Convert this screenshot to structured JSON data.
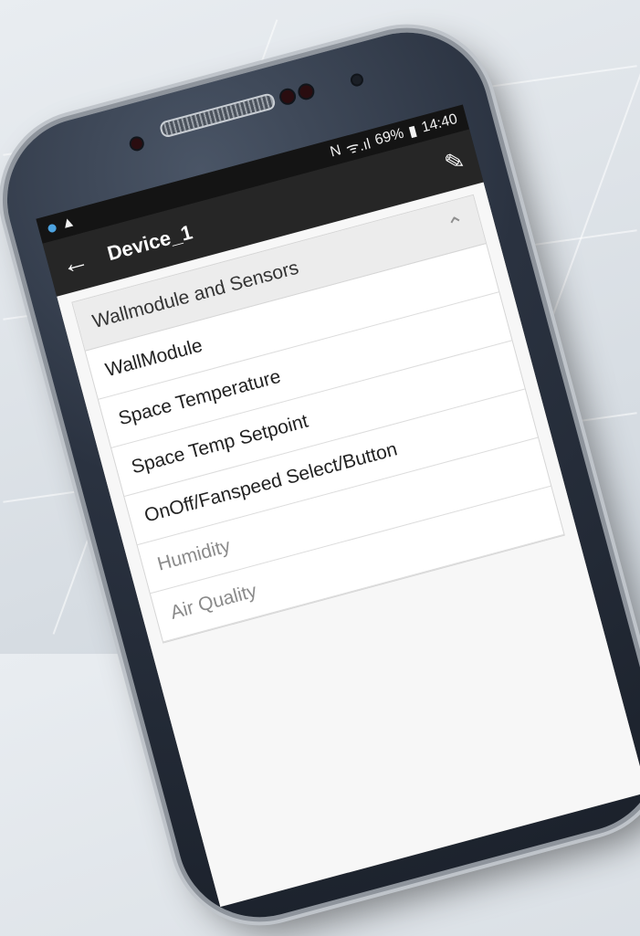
{
  "status": {
    "nfc": "N",
    "signal": "ᯤ.ıl",
    "battery_pct": "69%",
    "time": "14:40"
  },
  "appbar": {
    "back_icon": "←",
    "title": "Device_1",
    "edit_icon": "✎"
  },
  "section": {
    "title": "Wallmodule and Sensors",
    "chevron": "⌃"
  },
  "items": [
    {
      "label": "WallModule"
    },
    {
      "label": "Space Temperature"
    },
    {
      "label": "Space Temp Setpoint"
    },
    {
      "label": "OnOff/Fanspeed Select/Button"
    },
    {
      "label": "Humidity"
    },
    {
      "label": "Air Quality"
    }
  ]
}
